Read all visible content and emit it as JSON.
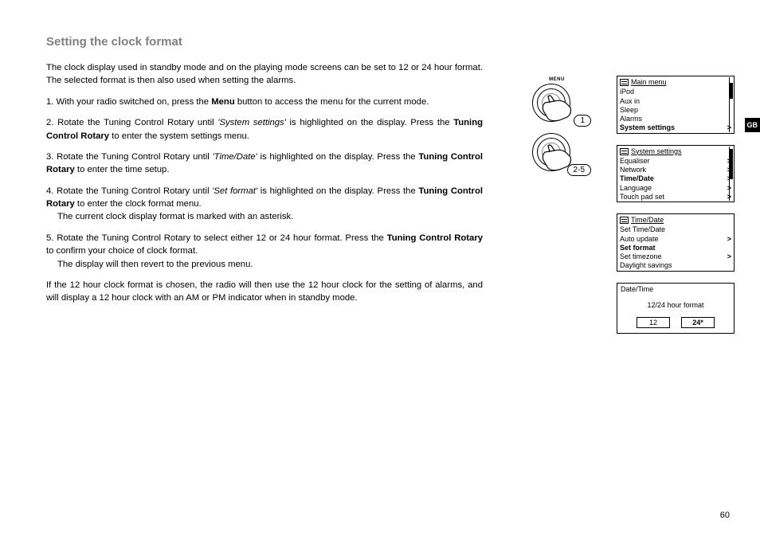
{
  "title": "Setting the clock format",
  "intro": "The clock display used in standby mode and on the playing mode screens can be set to 12 or 24 hour format. The selected format is then also used when setting the alarms.",
  "steps": {
    "s1_a": "1. With your radio switched on, press the ",
    "s1_b": "Menu",
    "s1_c": " button to access the menu for the current mode.",
    "s2_a": "2. Rotate the Tuning Control Rotary until ",
    "s2_i": "'System settings'",
    "s2_b": " is highlighted on the display. Press the ",
    "s2_bold": "Tuning Control Rotary",
    "s2_c": " to enter the system settings menu.",
    "s3_a": "3. Rotate the Tuning Control Rotary until ",
    "s3_i": "'Time/Date'",
    "s3_b": " is highlighted on the display. Press the ",
    "s3_bold": "Tuning Control Rotary",
    "s3_c": " to enter the time setup.",
    "s4_a": "4. Rotate the Tuning Control Rotary until ",
    "s4_i": "'Set format'",
    "s4_b": " is highlighted on the display. Press the ",
    "s4_bold": "Tuning Control Rotary",
    "s4_c": " to enter the clock format menu.",
    "s4_note": "The current clock display format is marked with an asterisk.",
    "s5_a": "5. Rotate the Tuning Control Rotary to select either 12 or 24 hour format. Press the ",
    "s5_bold": "Tuning Control Rotary",
    "s5_b": " to confirm your choice of clock format.",
    "s5_note": "The display will then revert to the previous menu."
  },
  "outro": "If the 12 hour clock format is chosen, the radio will then use the 12 hour clock for the setting of alarms, and will display a 12 hour clock with an AM or PM indicator when in standby mode.",
  "menu_label": "MENU",
  "badge1": "1",
  "badge2": "2-5",
  "screens": {
    "main": {
      "title": "Main menu",
      "items": [
        "iPod",
        "Aux in",
        "Sleep",
        "Alarms",
        "System settings"
      ],
      "bold": 4,
      "arrows": [
        4
      ]
    },
    "sys": {
      "title": "System settings",
      "items": [
        "Equaliser",
        "Network",
        "Time/Date",
        "Language",
        "Touch pad set"
      ],
      "bold": 2,
      "arrows": [
        0,
        1,
        2,
        3,
        4
      ]
    },
    "td": {
      "title": "Time/Date",
      "items": [
        "Set Time/Date",
        "Auto update",
        "Set format",
        "Set timezone",
        "Daylight savings"
      ],
      "bold": 2,
      "arrows": [
        1,
        3
      ]
    }
  },
  "dt": {
    "title": "Date/Time",
    "label": "12/24 hour format",
    "opt1": "12",
    "opt2": "24*"
  },
  "tab": "GB",
  "page": "60"
}
